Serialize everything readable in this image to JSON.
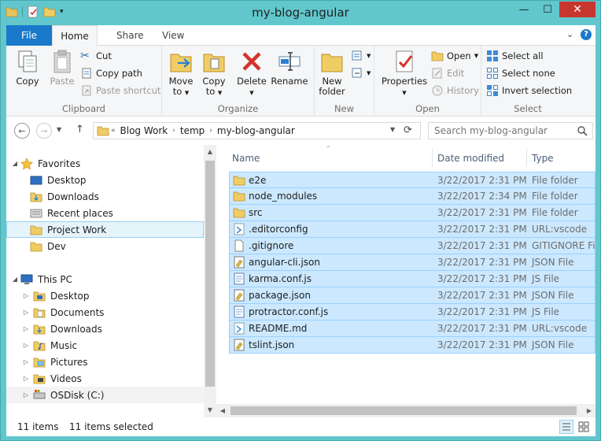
{
  "window": {
    "title": "my-blog-angular"
  },
  "ribbon_tabs": [
    "File",
    "Home",
    "Share",
    "View"
  ],
  "ribbon": {
    "clipboard": {
      "label": "Clipboard",
      "copy": "Copy",
      "paste": "Paste",
      "cut": "Cut",
      "copy_path": "Copy path",
      "paste_shortcut": "Paste shortcut"
    },
    "organize": {
      "label": "Organize",
      "move_to_1": "Move",
      "move_to_2": "to",
      "copy_to_1": "Copy",
      "copy_to_2": "to",
      "delete": "Delete",
      "rename": "Rename"
    },
    "new": {
      "label": "New",
      "new_folder_1": "New",
      "new_folder_2": "folder"
    },
    "open": {
      "label": "Open",
      "properties": "Properties",
      "open": "Open",
      "edit": "Edit",
      "history": "History"
    },
    "select": {
      "label": "Select",
      "select_all": "Select all",
      "select_none": "Select none",
      "invert_selection": "Invert selection"
    }
  },
  "address": {
    "prefix": "«",
    "crumbs": [
      "Blog Work",
      "temp",
      "my-blog-angular"
    ]
  },
  "search": {
    "placeholder": "Search my-blog-angular"
  },
  "nav": {
    "favorites": "Favorites",
    "desktop": "Desktop",
    "downloads": "Downloads",
    "recent_places": "Recent places",
    "project_work": "Project Work",
    "dev": "Dev",
    "this_pc": "This PC",
    "pc_desktop": "Desktop",
    "pc_documents": "Documents",
    "pc_downloads": "Downloads",
    "pc_music": "Music",
    "pc_pictures": "Pictures",
    "pc_videos": "Videos",
    "pc_osdisk": "OSDisk (C:)"
  },
  "columns": {
    "name": "Name",
    "date": "Date modified",
    "type": "Type"
  },
  "files": [
    {
      "name": "e2e",
      "date": "3/22/2017 2:31 PM",
      "type": "File folder",
      "icon": "folder-icon"
    },
    {
      "name": "node_modules",
      "date": "3/22/2017 2:34 PM",
      "type": "File folder",
      "icon": "folder-icon"
    },
    {
      "name": "src",
      "date": "3/22/2017 2:31 PM",
      "type": "File folder",
      "icon": "folder-icon"
    },
    {
      "name": ".editorconfig",
      "date": "3/22/2017 2:31 PM",
      "type": "URL:vscode",
      "icon": "vscode-file-icon"
    },
    {
      "name": ".gitignore",
      "date": "3/22/2017 2:31 PM",
      "type": "GITIGNORE File",
      "icon": "blank-file-icon"
    },
    {
      "name": "angular-cli.json",
      "date": "3/22/2017 2:31 PM",
      "type": "JSON File",
      "icon": "json-file-icon"
    },
    {
      "name": "karma.conf.js",
      "date": "3/22/2017 2:31 PM",
      "type": "JS File",
      "icon": "js-file-icon"
    },
    {
      "name": "package.json",
      "date": "3/22/2017 2:31 PM",
      "type": "JSON File",
      "icon": "json-file-icon"
    },
    {
      "name": "protractor.conf.js",
      "date": "3/22/2017 2:31 PM",
      "type": "JS File",
      "icon": "js-file-icon"
    },
    {
      "name": "README.md",
      "date": "3/22/2017 2:31 PM",
      "type": "URL:vscode",
      "icon": "vscode-file-icon"
    },
    {
      "name": "tslint.json",
      "date": "3/22/2017 2:31 PM",
      "type": "JSON File",
      "icon": "json-file-icon"
    }
  ],
  "status": {
    "items": "11 items",
    "selected": "11 items selected"
  },
  "colors": {
    "title_bar": "#61c7cc",
    "file_tab": "#1979ca",
    "selection": "#cce8ff",
    "selection_border": "#99d1ff",
    "close_button": "#c7372f"
  }
}
